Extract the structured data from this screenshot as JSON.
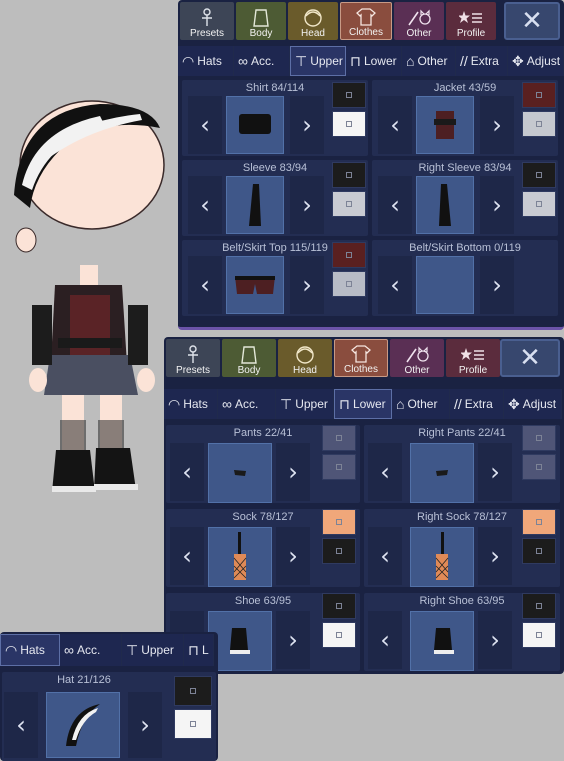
{
  "tabs": [
    {
      "label": "Presets",
      "icon": "mannequin-icon"
    },
    {
      "label": "Body",
      "icon": "body-icon"
    },
    {
      "label": "Head",
      "icon": "head-icon"
    },
    {
      "label": "Clothes",
      "icon": "shirt-icon"
    },
    {
      "label": "Other",
      "icon": "cat-sword-icon"
    },
    {
      "label": "Profile",
      "icon": "star-list-icon"
    }
  ],
  "close_label": "✕",
  "subtabs_top": [
    {
      "label": "Hats",
      "icon": "cap-icon"
    },
    {
      "label": "Acc.",
      "icon": "glasses-icon"
    },
    {
      "label": "Upper",
      "icon": "shirt-outline-icon"
    },
    {
      "label": "Lower",
      "icon": "skirt-icon"
    },
    {
      "label": "Other",
      "icon": "shoe-icon"
    },
    {
      "label": "Extra",
      "icon": "slash-icon"
    },
    {
      "label": "Adjust",
      "icon": "move-icon"
    }
  ],
  "subtabs_bottom_panel": [
    {
      "label": "Hats",
      "icon": "cap-icon"
    },
    {
      "label": "Acc.",
      "icon": "glasses-icon"
    },
    {
      "label": "Upper",
      "icon": "shirt-outline-icon"
    },
    {
      "label": "L",
      "icon": "skirt-icon"
    }
  ],
  "upper_items": [
    {
      "title": "Shirt 84/114",
      "swatch_top": "#1c1c1c",
      "swatch_bottom": "#f5f5f5"
    },
    {
      "title": "Jacket 43/59",
      "swatch_top": "#5a2020",
      "swatch_bottom": "#c5c8cf"
    },
    {
      "title": "Sleeve 83/94",
      "swatch_top": "#1c1c1c",
      "swatch_bottom": "#c9cbd2"
    },
    {
      "title": "Right Sleeve 83/94",
      "swatch_top": "#1c1c1c",
      "swatch_bottom": "#c9cbd2"
    },
    {
      "title": "Belt/Skirt Top 115/119",
      "swatch_top": "#5a2020",
      "swatch_bottom": "#b8bcc6"
    },
    {
      "title": "Belt/Skirt Bottom 0/119",
      "swatch_top": "",
      "swatch_bottom": ""
    }
  ],
  "lower_items": [
    {
      "title": "Pants 22/41",
      "swatch_top": "#4f5577",
      "swatch_bottom": "#4f5577"
    },
    {
      "title": "Right Pants 22/41",
      "swatch_top": "#4f5577",
      "swatch_bottom": "#4f5577"
    },
    {
      "title": "Sock 78/127",
      "swatch_top": "#f0a77a",
      "swatch_bottom": "#1c1c1c"
    },
    {
      "title": "Right Sock 78/127",
      "swatch_top": "#f0a77a",
      "swatch_bottom": "#1c1c1c"
    },
    {
      "title": "Shoe 63/95",
      "swatch_top": "#1c1c1c",
      "swatch_bottom": "#f5f5f5"
    },
    {
      "title": "Right Shoe 63/95",
      "swatch_top": "#1c1c1c",
      "swatch_bottom": "#f5f5f5"
    }
  ],
  "hat_item": {
    "title": "Hat 21/126",
    "swatch_top": "#1c1c1c",
    "swatch_bottom": "#f5f5f5"
  },
  "arrows": {
    "left": "‹",
    "right": "›"
  },
  "colors": {
    "panel_bg": "#1a2242",
    "accent": "#6b53a8"
  }
}
